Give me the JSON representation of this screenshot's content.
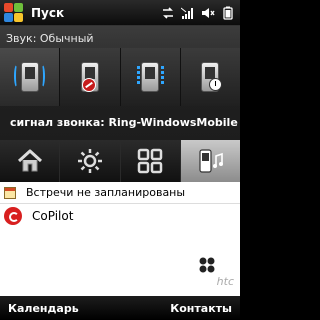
{
  "statusbar": {
    "title": "Пуск",
    "icons": [
      "start-logo",
      "sync-icon",
      "signal-strength-icon",
      "volume-icon",
      "battery-icon"
    ]
  },
  "sound": {
    "header": "Звук: Обычный",
    "profiles": [
      {
        "icon": "phone-ring-icon",
        "active": true
      },
      {
        "icon": "phone-silent-icon",
        "active": false
      },
      {
        "icon": "phone-vibrate-icon",
        "active": false
      },
      {
        "icon": "phone-scheduled-icon",
        "active": false
      }
    ],
    "ringtone": "сигнал звонка: Ring-WindowsMobile"
  },
  "tabs": [
    {
      "icon": "home-icon",
      "active": false
    },
    {
      "icon": "sun-icon",
      "active": false
    },
    {
      "icon": "apps-grid-icon",
      "active": false
    },
    {
      "icon": "phone-music-icon",
      "active": true
    }
  ],
  "today": {
    "appointment": "Встречи не запланированы",
    "app": "CoPilot",
    "brand": "htc"
  },
  "softkeys": {
    "left": "Календарь",
    "right": "Контакты"
  },
  "colors": {
    "accent": "#2ea6ff",
    "mute_red": "#c61b1b",
    "copilot_red": "#d81f1f"
  }
}
